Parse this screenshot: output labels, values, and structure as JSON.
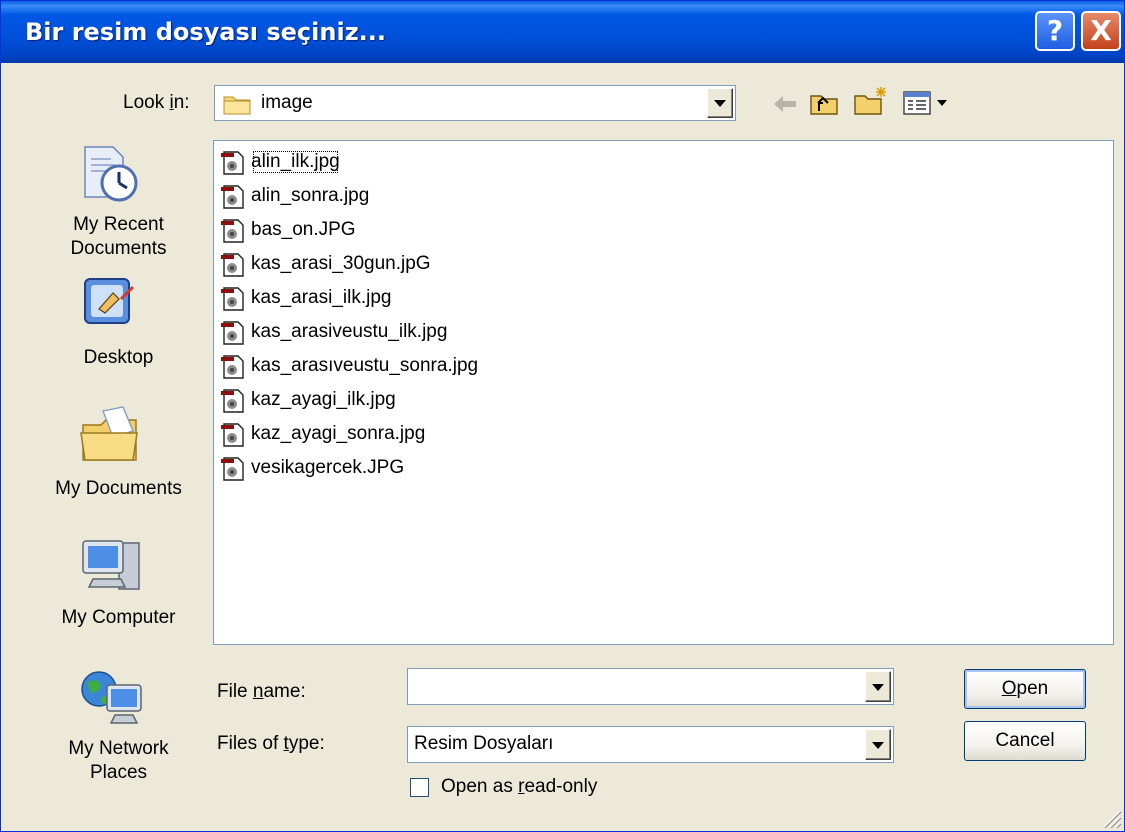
{
  "window": {
    "title": "Bir resim dosyası seçiniz...",
    "help_glyph": "?",
    "close_glyph": "X"
  },
  "lookin": {
    "label_pre": "Look ",
    "label_key": "i",
    "label_post": "n:",
    "value": "image"
  },
  "places": [
    {
      "label_line1": "My Recent",
      "label_line2": "Documents",
      "icon": "recent-documents-icon"
    },
    {
      "label_line1": "Desktop",
      "label_line2": "",
      "icon": "desktop-icon"
    },
    {
      "label_line1": "My Documents",
      "label_line2": "",
      "icon": "my-documents-icon"
    },
    {
      "label_line1": "My Computer",
      "label_line2": "",
      "icon": "my-computer-icon"
    },
    {
      "label_line1": "My Network",
      "label_line2": "Places",
      "icon": "network-places-icon"
    }
  ],
  "files": [
    "alin_ilk.jpg",
    "alin_sonra.jpg",
    "bas_on.JPG",
    "kas_arasi_30gun.jpG",
    "kas_arasi_ilk.jpg",
    "kas_arasiveustu_ilk.jpg",
    "kas_arasıveustu_sonra.jpg",
    "kaz_ayagi_ilk.jpg",
    "kaz_ayagi_sonra.jpg",
    "vesikagercek.JPG"
  ],
  "filename": {
    "label_pre": "File ",
    "label_key": "n",
    "label_post": "ame:",
    "value": ""
  },
  "filetype": {
    "label_pre": "Files of ",
    "label_key": "t",
    "label_post": "ype:",
    "value": "Resim Dosyaları"
  },
  "readonly": {
    "label_pre": "Open as ",
    "label_key": "r",
    "label_post": "ead-only",
    "checked": false
  },
  "buttons": {
    "open_key": "O",
    "open_rest": "pen",
    "cancel": "Cancel"
  },
  "colors": {
    "titlebar": "#0054e3",
    "dialog_bg": "#ece9d8",
    "list_border": "#7f9db9"
  }
}
